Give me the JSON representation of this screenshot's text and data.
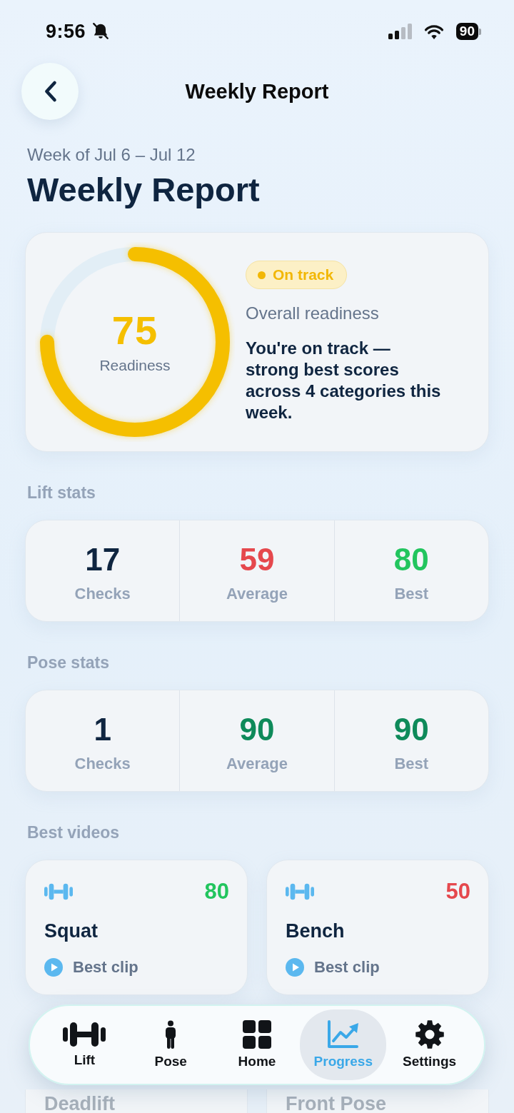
{
  "status_bar": {
    "time": "9:56",
    "battery": "90"
  },
  "header": {
    "title": "Weekly Report"
  },
  "intro": {
    "week": "Week of Jul 6 – Jul 12",
    "heading": "Weekly Report"
  },
  "readiness": {
    "score": "75",
    "score_label": "Readiness",
    "level": 0.75,
    "badge": "On track",
    "caption": "Overall readiness",
    "message": "You're on track — strong best scores across 4 categories this week."
  },
  "stat_sections": [
    {
      "title": "Lift stats",
      "stats": [
        {
          "value": "17",
          "label": "Checks",
          "color": "#0f2540"
        },
        {
          "value": "59",
          "label": "Average",
          "color": "#e5484d"
        },
        {
          "value": "80",
          "label": "Best",
          "color": "#22c55e"
        }
      ]
    },
    {
      "title": "Pose stats",
      "stats": [
        {
          "value": "1",
          "label": "Checks",
          "color": "#0f2540"
        },
        {
          "value": "90",
          "label": "Average",
          "color": "#0e8a5a"
        },
        {
          "value": "90",
          "label": "Best",
          "color": "#0e8a5a"
        }
      ]
    }
  ],
  "best_videos": {
    "title": "Best videos",
    "cards": [
      {
        "name": "Squat",
        "score": "80",
        "color": "#22c55e",
        "link": "Best clip"
      },
      {
        "name": "Bench",
        "score": "50",
        "color": "#e5484d",
        "link": "Best clip"
      },
      {
        "name": "Deadlift"
      },
      {
        "name": "Front Pose"
      }
    ]
  },
  "tab_bar": [
    {
      "label": "Lift",
      "selected": false
    },
    {
      "label": "Pose",
      "selected": false
    },
    {
      "label": "Home",
      "selected": false
    },
    {
      "label": "Progress",
      "selected": true
    },
    {
      "label": "Settings",
      "selected": false
    }
  ]
}
